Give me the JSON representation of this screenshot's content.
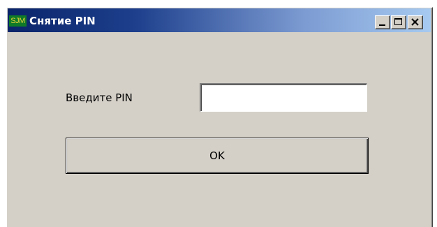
{
  "window": {
    "icon_text": "SJM",
    "title": "Снятие PIN",
    "controls": {
      "minimize": "minimize-icon",
      "maximize": "maximize-icon",
      "close": "close-icon"
    }
  },
  "form": {
    "pin_label": "Введите PIN",
    "pin_value": "",
    "ok_label": "OK"
  },
  "colors": {
    "titlebar_start": "#0a246a",
    "titlebar_end": "#a6caf0",
    "face": "#d4d0c8",
    "icon_bg": "#0f7a28",
    "icon_text": "#e8d23a"
  }
}
